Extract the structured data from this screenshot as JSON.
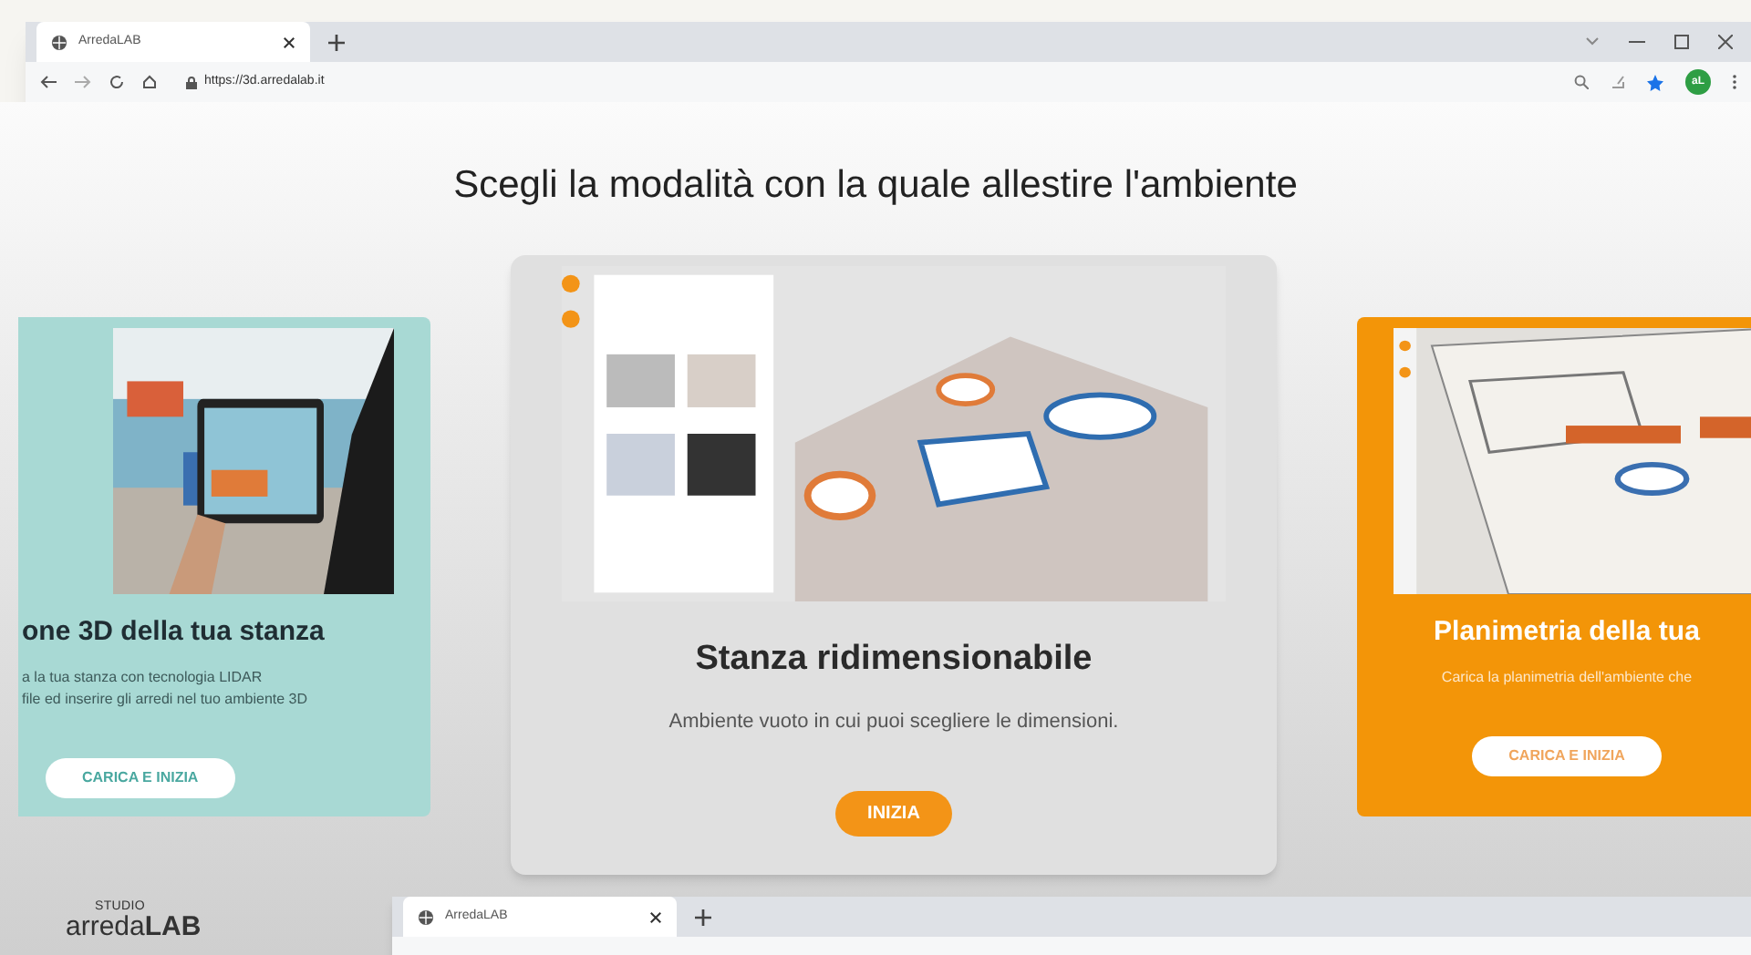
{
  "browser": {
    "tab_title": "ArredaLAB",
    "address": "https://3d.arredalab.it",
    "profile_initials": "aL"
  },
  "heading": "Scegli la modalità con la quale allestire l'ambiente",
  "cards": [
    {
      "kind": "teal",
      "title": "one 3D della tua stanza",
      "lines": [
        "a la tua stanza con tecnologia LIDAR",
        "file ed inserire gli arredi nel tuo ambiente 3D"
      ],
      "button": "CARICA E INIZIA"
    },
    {
      "kind": "gray",
      "title": "Stanza ridimensionabile",
      "lines": [
        "Ambiente vuoto in cui puoi scegliere le dimensioni."
      ],
      "button": "INIZIA"
    },
    {
      "kind": "orange",
      "title": "Planimetria della tua",
      "lines": [
        "Carica la planimetria dell'ambiente che"
      ],
      "button": "CARICA E INIZIA"
    }
  ],
  "logo": {
    "top": "STUDIO",
    "prefix": "arreda",
    "suffix": "LAB"
  },
  "second_window": {
    "tab_title": "ArredaLAB"
  }
}
